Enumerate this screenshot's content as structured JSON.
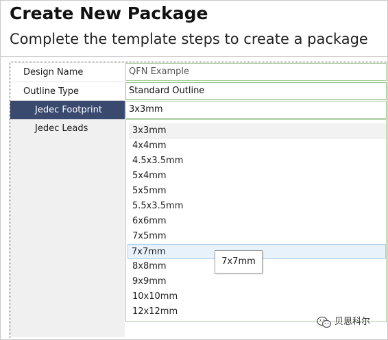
{
  "header": {
    "title": "Create New Package",
    "subtitle": "Complete the template steps to create a package"
  },
  "properties": [
    {
      "label": "Design Name",
      "value": "QFN Example"
    },
    {
      "label": "Outline Type",
      "value": "Standard Outline"
    },
    {
      "label": "Jedec Footprint",
      "value": "3x3mm",
      "selected": true
    },
    {
      "label": "Jedec Leads",
      "value": ""
    }
  ],
  "dropdown": {
    "options": [
      "3x3mm",
      "4x4mm",
      "4.5x3.5mm",
      "5x4mm",
      "5x5mm",
      "5.5x3.5mm",
      "6x6mm",
      "7x5mm",
      "7x7mm",
      "8x8mm",
      "9x9mm",
      "10x10mm",
      "12x12mm"
    ],
    "current": "3x3mm",
    "hovered": "7x7mm"
  },
  "tooltip": {
    "text": "7x7mm"
  },
  "watermark": {
    "text": "贝思科尔",
    "icon": "wechat-icon"
  },
  "colors": {
    "selected_row": "#3a4a6e",
    "field_border": "#8fbf7f",
    "hover_option": "#e8f2fb"
  }
}
